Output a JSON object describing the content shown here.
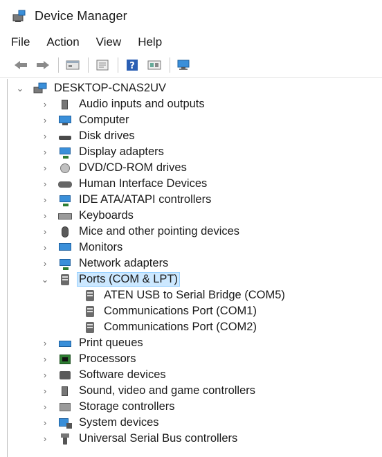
{
  "window": {
    "title": "Device Manager"
  },
  "menu": [
    "File",
    "Action",
    "View",
    "Help"
  ],
  "tree": {
    "root": "DESKTOP-CNAS2UV",
    "nodes": [
      {
        "label": "Audio inputs and outputs",
        "icon": "speaker-icon",
        "expanded": false
      },
      {
        "label": "Computer",
        "icon": "computer-icon",
        "expanded": false
      },
      {
        "label": "Disk drives",
        "icon": "disk-drive-icon",
        "expanded": false
      },
      {
        "label": "Display adapters",
        "icon": "display-adapter-icon",
        "expanded": false
      },
      {
        "label": "DVD/CD-ROM drives",
        "icon": "dvd-drive-icon",
        "expanded": false
      },
      {
        "label": "Human Interface Devices",
        "icon": "hid-icon",
        "expanded": false
      },
      {
        "label": "IDE ATA/ATAPI controllers",
        "icon": "ide-controller-icon",
        "expanded": false
      },
      {
        "label": "Keyboards",
        "icon": "keyboard-icon",
        "expanded": false
      },
      {
        "label": "Mice and other pointing devices",
        "icon": "mouse-icon",
        "expanded": false
      },
      {
        "label": "Monitors",
        "icon": "monitor-icon",
        "expanded": false
      },
      {
        "label": "Network adapters",
        "icon": "network-adapter-icon",
        "expanded": false
      },
      {
        "label": "Ports (COM & LPT)",
        "icon": "port-icon",
        "expanded": true,
        "selected": true,
        "children": [
          "ATEN USB to Serial Bridge (COM5)",
          "Communications Port (COM1)",
          "Communications Port (COM2)"
        ]
      },
      {
        "label": "Print queues",
        "icon": "printer-icon",
        "expanded": false
      },
      {
        "label": "Processors",
        "icon": "processor-icon",
        "expanded": false
      },
      {
        "label": "Software devices",
        "icon": "software-device-icon",
        "expanded": false
      },
      {
        "label": "Sound, video and game controllers",
        "icon": "speaker-icon",
        "expanded": false
      },
      {
        "label": "Storage controllers",
        "icon": "storage-controller-icon",
        "expanded": false
      },
      {
        "label": "System devices",
        "icon": "system-device-icon",
        "expanded": false
      },
      {
        "label": "Universal Serial Bus controllers",
        "icon": "usb-icon",
        "expanded": false
      }
    ]
  },
  "colors": {
    "selection_bg": "#cce8ff",
    "selection_border": "#99d1ff",
    "accent": "#3a8fd9"
  }
}
